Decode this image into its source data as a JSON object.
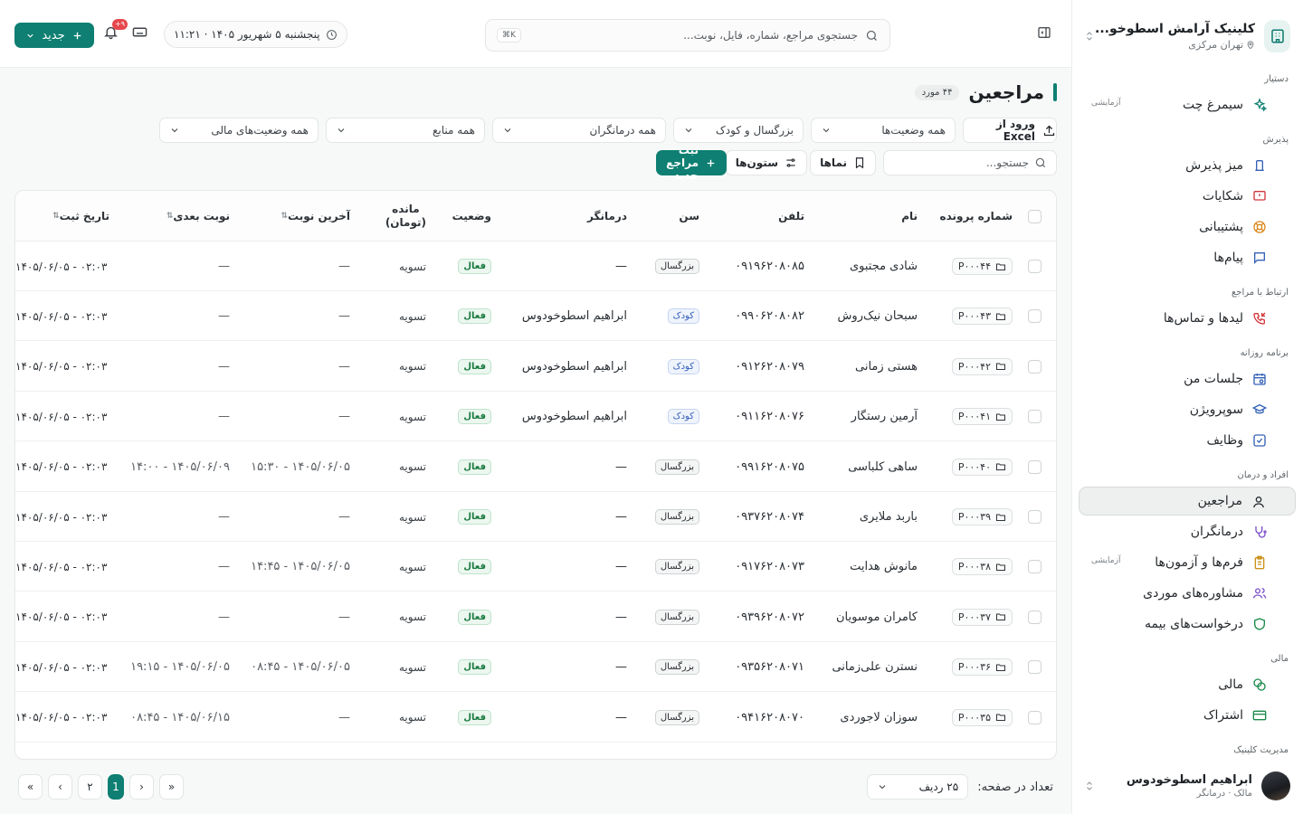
{
  "sidebar": {
    "clinic_name": "کلینیک آرامش اسطوخو...",
    "clinic_branch": "تهران مرکزی",
    "sections": {
      "assistant": "دستیار",
      "reception": "پذیرش",
      "contact": "ارتباط با مراجع",
      "daily": "برنامه روزانه",
      "people": "افراد و درمان",
      "finance": "مالی",
      "management": "مدیریت کلینیک"
    },
    "items": {
      "simorgh": "سیمرغ چت",
      "simorgh_badge": "آزمایشی",
      "reception_desk": "میز پذیرش",
      "complaints": "شکایات",
      "support": "پشتیبانی",
      "messages": "پیام‌ها",
      "leads": "لیدها و تماس‌ها",
      "my_sessions": "جلسات من",
      "supervision": "سوپرویژن",
      "tasks": "وظایف",
      "clients": "مراجعین",
      "therapists": "درمانگران",
      "forms": "فرم‌ها و آزمون‌ها",
      "forms_badge": "آزمایشی",
      "case_consults": "مشاوره‌های موردی",
      "insurance": "درخواست‌های بیمه",
      "finance": "مالی",
      "subscription": "اشتراک"
    },
    "user": {
      "name": "ابراهیم اسطوخودوس",
      "role": "مالک · درمانگر"
    }
  },
  "topbar": {
    "search_placeholder": "جستجوی مراجع، شماره، فایل، نوبت...",
    "shortcut": "⌘K",
    "datetime": "پنجشنبه ۵ شهریور ۱۴۰۵ · ۱۱:۲۱",
    "notif_count": "۹+",
    "new_label": "جدید"
  },
  "page": {
    "title": "مراجعین",
    "count": "۴۴ مورد",
    "import_excel": "ورود از Excel",
    "filter_status": "همه وضعیت‌ها",
    "filter_age": "بزرگسال و کودک",
    "filter_therapists": "همه درمانگران",
    "filter_sources": "همه منابع",
    "filter_finance": "همه وضعیت‌های مالی",
    "search_placeholder": "جستجو...",
    "views": "نماها",
    "columns": "ستون‌ها",
    "add_client": "ثبت مراجع جدید"
  },
  "table": {
    "headers": {
      "file_no": "شماره پرونده",
      "name": "نام",
      "phone": "تلفن",
      "age": "سن",
      "therapist": "درمانگر",
      "status": "وضعیت",
      "balance_1": "مانده",
      "balance_2": "(تومان)",
      "last_appt": "آخرین نوبت",
      "next_appt": "نوبت بعدی",
      "registered": "تاریخ ثبت"
    },
    "rows": [
      {
        "file": "P۰۰۰۴۴",
        "name": "شادی مجتبوی",
        "phone": "۰۹۱۹۶۲۰۸۰۸۵",
        "age": "بزرگسال",
        "age_type": "adult",
        "therapist": "—",
        "status": "فعال",
        "balance": "تسویه",
        "last": "—",
        "next": "—",
        "reg": "۱۴۰۵/۰۶/۰۵ - ۰۲:۰۳"
      },
      {
        "file": "P۰۰۰۴۳",
        "name": "سبحان نیک‌روش",
        "phone": "۰۹۹۰۶۲۰۸۰۸۲",
        "age": "کودک",
        "age_type": "child",
        "therapist": "ابراهیم اسطوخودوس",
        "status": "فعال",
        "balance": "تسویه",
        "last": "—",
        "next": "—",
        "reg": "۱۴۰۵/۰۶/۰۵ - ۰۲:۰۳"
      },
      {
        "file": "P۰۰۰۴۲",
        "name": "هستی زمانی",
        "phone": "۰۹۱۲۶۲۰۸۰۷۹",
        "age": "کودک",
        "age_type": "child",
        "therapist": "ابراهیم اسطوخودوس",
        "status": "فعال",
        "balance": "تسویه",
        "last": "—",
        "next": "—",
        "reg": "۱۴۰۵/۰۶/۰۵ - ۰۲:۰۳"
      },
      {
        "file": "P۰۰۰۴۱",
        "name": "آرمین رستگار",
        "phone": "۰۹۱۱۶۲۰۸۰۷۶",
        "age": "کودک",
        "age_type": "child",
        "therapist": "ابراهیم اسطوخودوس",
        "status": "فعال",
        "balance": "تسویه",
        "last": "—",
        "next": "—",
        "reg": "۱۴۰۵/۰۶/۰۵ - ۰۲:۰۳"
      },
      {
        "file": "P۰۰۰۴۰",
        "name": "ساهی کلباسی",
        "phone": "۰۹۹۱۶۲۰۸۰۷۵",
        "age": "بزرگسال",
        "age_type": "adult",
        "therapist": "—",
        "status": "فعال",
        "balance": "تسویه",
        "last": "۱۴۰۵/۰۶/۰۵ - ۱۵:۳۰",
        "next": "۱۴۰۵/۰۶/۰۹ - ۱۴:۰۰",
        "reg": "۱۴۰۵/۰۶/۰۵ - ۰۲:۰۳"
      },
      {
        "file": "P۰۰۰۳۹",
        "name": "باربد ملایری",
        "phone": "۰۹۳۷۶۲۰۸۰۷۴",
        "age": "بزرگسال",
        "age_type": "adult",
        "therapist": "—",
        "status": "فعال",
        "balance": "تسویه",
        "last": "—",
        "next": "—",
        "reg": "۱۴۰۵/۰۶/۰۵ - ۰۲:۰۳"
      },
      {
        "file": "P۰۰۰۳۸",
        "name": "مانوش هدایت",
        "phone": "۰۹۱۷۶۲۰۸۰۷۳",
        "age": "بزرگسال",
        "age_type": "adult",
        "therapist": "—",
        "status": "فعال",
        "balance": "تسویه",
        "last": "۱۴۰۵/۰۶/۰۵ - ۱۴:۴۵",
        "next": "—",
        "reg": "۱۴۰۵/۰۶/۰۵ - ۰۲:۰۳"
      },
      {
        "file": "P۰۰۰۳۷",
        "name": "کامران موسویان",
        "phone": "۰۹۳۹۶۲۰۸۰۷۲",
        "age": "بزرگسال",
        "age_type": "adult",
        "therapist": "—",
        "status": "فعال",
        "balance": "تسویه",
        "last": "—",
        "next": "—",
        "reg": "۱۴۰۵/۰۶/۰۵ - ۰۲:۰۳"
      },
      {
        "file": "P۰۰۰۳۶",
        "name": "نسترن علی‌زمانی",
        "phone": "۰۹۳۵۶۲۰۸۰۷۱",
        "age": "بزرگسال",
        "age_type": "adult",
        "therapist": "—",
        "status": "فعال",
        "balance": "تسویه",
        "last": "۱۴۰۵/۰۶/۰۵ - ۰۸:۴۵",
        "next": "۱۴۰۵/۰۶/۰۵ - ۱۹:۱۵",
        "reg": "۱۴۰۵/۰۶/۰۵ - ۰۲:۰۳"
      },
      {
        "file": "P۰۰۰۳۵",
        "name": "سوزان لاجوردی",
        "phone": "۰۹۴۱۶۲۰۸۰۷۰",
        "age": "بزرگسال",
        "age_type": "adult",
        "therapist": "—",
        "status": "فعال",
        "balance": "تسویه",
        "last": "—",
        "next": "۱۴۰۵/۰۶/۱۵ - ۰۸:۴۵",
        "reg": "۱۴۰۵/۰۶/۰۵ - ۰۲:۰۳"
      }
    ]
  },
  "pagination": {
    "rows_label": "تعداد در صفحه:",
    "rows_value": "۲۵ ردیف",
    "first": "«",
    "prev": "‹",
    "page_1": "1",
    "page_2": "۲",
    "next": "›",
    "last": "»"
  },
  "colors": {
    "accent": "#0e7f72",
    "active_status": "#1a7a3f",
    "child_chip": "#3560b8"
  }
}
